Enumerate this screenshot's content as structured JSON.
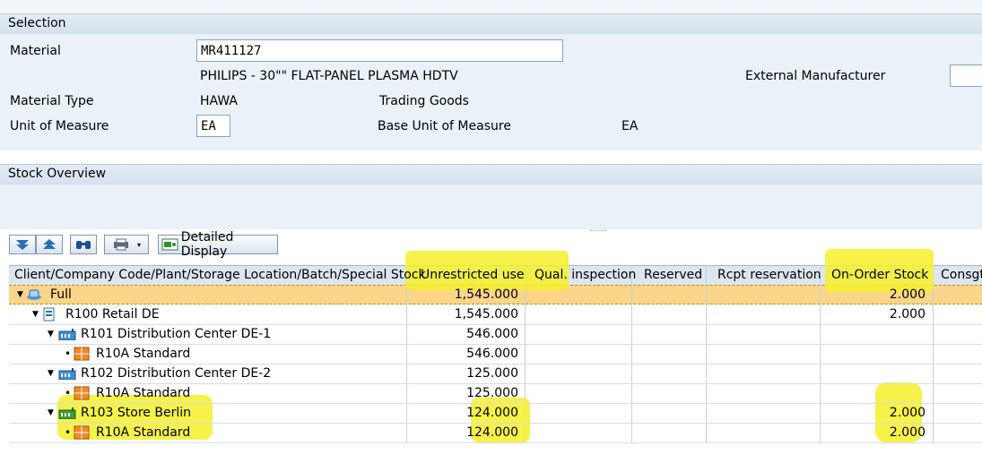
{
  "selection": {
    "title": "Selection",
    "material_label": "Material",
    "material_value": "MR411127",
    "material_desc": "PHILIPS - 30\"\" FLAT-PANEL PLASMA HDTV",
    "ext_manufacturer_label": "External Manufacturer",
    "material_type_label": "Material Type",
    "material_type_code": "HAWA",
    "material_type_desc": "Trading Goods",
    "uom_label": "Unit of Measure",
    "uom_value": "EA",
    "base_uom_label": "Base Unit of Measure",
    "base_uom_value": "EA"
  },
  "stock": {
    "title": "Stock Overview",
    "splitter": "......",
    "detailed_display": "Detailed Display",
    "columns": [
      "Client/Company Code/Plant/Storage Location/Batch/Special Stock",
      "Unrestricted use",
      "Qual. inspection",
      "Reserved",
      "Rcpt reservation",
      "On-Order Stock",
      "Consgt"
    ],
    "rows": [
      {
        "label": "Full",
        "unrestricted": "1,545.000",
        "onorder": "2.000"
      },
      {
        "label": "R100 Retail DE",
        "unrestricted": "1,545.000",
        "onorder": "2.000"
      },
      {
        "label": "R101 Distribution Center DE-1",
        "unrestricted": "546.000",
        "onorder": ""
      },
      {
        "label": "R10A Standard",
        "unrestricted": "546.000",
        "onorder": ""
      },
      {
        "label": "R102 Distribution Center DE-2",
        "unrestricted": "125.000",
        "onorder": ""
      },
      {
        "label": "R10A Standard",
        "unrestricted": "125.000",
        "onorder": ""
      },
      {
        "label": "R103 Store Berlin",
        "unrestricted": "124.000",
        "onorder": "2.000"
      },
      {
        "label": "R10A Standard",
        "unrestricted": "124.000",
        "onorder": "2.000"
      }
    ]
  },
  "colors": {
    "highlight": "#f5f02a",
    "selected_row": "#fbd58a",
    "header_bg": "#dbe6f1"
  }
}
